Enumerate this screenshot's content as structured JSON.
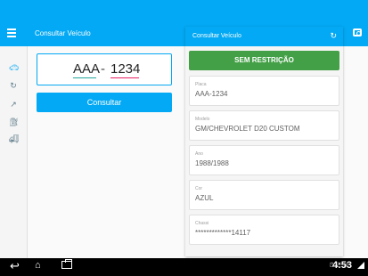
{
  "app": {
    "title": "Consultar Veículo"
  },
  "rail": {
    "items": [
      "car-icon",
      "history-icon",
      "trend-icon",
      "fuel-icon",
      "truck-icon"
    ]
  },
  "form": {
    "plate_letters": "AAA",
    "plate_separator": "-",
    "plate_numbers": "1234",
    "submit_label": "Consultar"
  },
  "result": {
    "title": "Consultar Veículo",
    "status": "SEM RESTRIÇÃO",
    "fields": [
      {
        "label": "Placa",
        "value": "AAA-1234"
      },
      {
        "label": "Modelo",
        "value": "GM/CHEVROLET D20 CUSTOM"
      },
      {
        "label": "Ano",
        "value": "1988/1988"
      },
      {
        "label": "Cor",
        "value": "AZUL"
      },
      {
        "label": "Chassi",
        "value": "*************14117"
      }
    ]
  },
  "system": {
    "clock": "4:53"
  },
  "colors": {
    "primary": "#03a9f4",
    "success": "#43a047"
  }
}
